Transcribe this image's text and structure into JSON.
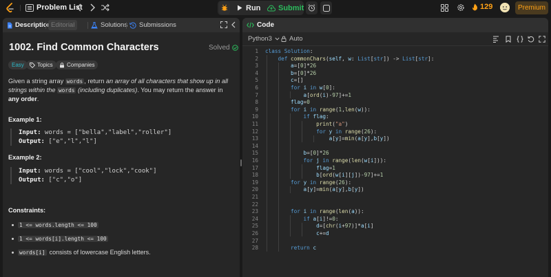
{
  "topbar": {
    "problem_list": "Problem List",
    "run_label": "Run",
    "submit_label": "Submit",
    "streak_count": "129",
    "premium_label": "Premium"
  },
  "left_tabs": {
    "description": "Description",
    "editorial": "Editorial",
    "solutions": "Solutions",
    "submissions": "Submissions"
  },
  "problem": {
    "title": "1002. Find Common Characters",
    "status": "Solved",
    "tags": [
      "Easy",
      "Topics",
      "Companies"
    ],
    "desc_1": "Given a string array ",
    "desc_code_1": "words",
    "desc_2": ", return ",
    "desc_3": "an array of all characters that show up in all strings within the ",
    "desc_code_2": "words",
    "desc_4": " (including duplicates)",
    "desc_5": ". You may return the answer in ",
    "desc_6": "any order",
    "desc_7": "."
  },
  "examples": [
    {
      "title": "Example 1:",
      "input_label": "Input:",
      "input": " words = [\"bella\",\"label\",\"roller\"]",
      "output_label": "Output:",
      "output": " [\"e\",\"l\",\"l\"]"
    },
    {
      "title": "Example 2:",
      "input_label": "Input:",
      "input": " words = [\"cool\",\"lock\",\"cook\"]",
      "output_label": "Output:",
      "output": " [\"c\",\"o\"]"
    }
  ],
  "constraints": {
    "title": "Constraints:",
    "items": [
      {
        "code": "1 <= words.length <= 100",
        "text": ""
      },
      {
        "code": "1 <= words[i].length <= 100",
        "text": ""
      },
      {
        "code": "words[i]",
        "text": "consists of lowercase English letters."
      }
    ]
  },
  "code_panel": {
    "tab_label": "Code",
    "language": "Python3",
    "auto_label": "Auto",
    "lines": [
      "class Solution:",
      "    def commonChars(self, w: List[str]) -> List[str]:",
      "        a=[0]*26",
      "        b=[0]*26",
      "        c=[]",
      "        for i in w[0]:",
      "            a[ord(i)-97]+=1",
      "        flag=0",
      "        for i in range(1,len(w)):",
      "            if flag:",
      "                print(\"a\")",
      "                for y in range(26):",
      "                    a[y]=min(a[y],b[y])",
      "",
      "            b=[0]*26",
      "            for j in range(len(w[i])):",
      "                flag=1",
      "                b[ord(w[i][j])-97]+=1",
      "        for y in range(26):",
      "            a[y]=min(a[y],b[y])",
      "",
      "",
      "        for i in range(len(a)):",
      "            if a[i]!=0:",
      "                d=[chr(i+97)]*a[i]",
      "                c+=d",
      "",
      "        return c"
    ]
  }
}
